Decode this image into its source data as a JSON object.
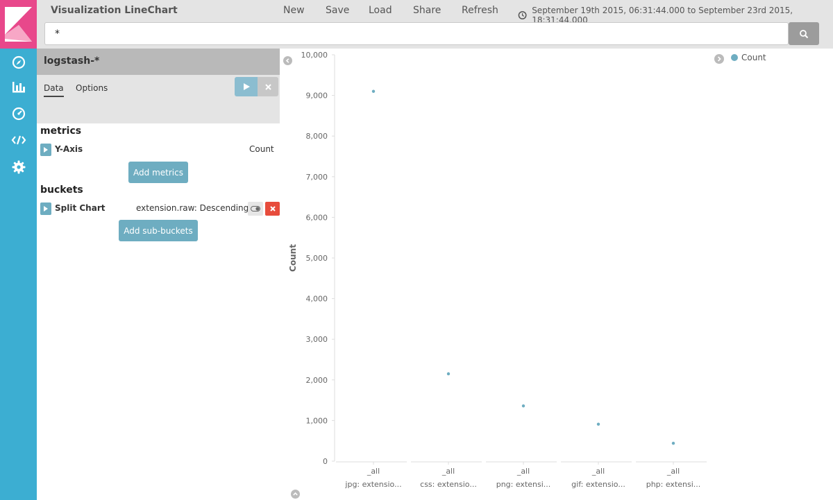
{
  "app": {
    "title": "Visualization LineChart",
    "brand_color": "#e8488b",
    "nav_color": "#3caed2"
  },
  "nav": {
    "icons": [
      "compass-icon",
      "bar-chart-icon",
      "dashboard-gauge-icon",
      "code-icon",
      "gear-icon"
    ]
  },
  "menu": {
    "new": "New",
    "save": "Save",
    "load": "Load",
    "share": "Share",
    "refresh": "Refresh"
  },
  "timerange": {
    "label": "September 19th 2015, 06:31:44.000 to September 23rd 2015, 18:31:44.000"
  },
  "search": {
    "value": "*"
  },
  "sidebar": {
    "index_pattern": "logstash-*",
    "tabs": [
      {
        "label": "Data",
        "active": true
      },
      {
        "label": "Options",
        "active": false
      }
    ],
    "metrics_title": "metrics",
    "metric_agg": {
      "title": "Y-Axis",
      "description": "Count"
    },
    "add_metrics_label": "Add metrics",
    "buckets_title": "buckets",
    "bucket_agg": {
      "title": "Split Chart",
      "description": "extension.raw: Descending"
    },
    "add_buckets_label": "Add sub-buckets"
  },
  "chart_data": {
    "type": "scatter",
    "title": "",
    "ylabel": "Count",
    "xlabel": "",
    "ylim": [
      0,
      10000
    ],
    "yticks": [
      0,
      1000,
      2000,
      3000,
      4000,
      5000,
      6000,
      7000,
      8000,
      9000,
      10000
    ],
    "ytick_labels": [
      "0",
      "1,000",
      "2,000",
      "3,000",
      "4,000",
      "5,000",
      "6,000",
      "7,000",
      "8,000",
      "9,000",
      "10,000"
    ],
    "grid": false,
    "legend": "top-right",
    "series": [
      {
        "name": "Count",
        "color": "#6eadc1",
        "points": [
          {
            "panel": "jpg: extensio...",
            "x": "_all",
            "y": 9100
          },
          {
            "panel": "css: extensio...",
            "x": "_all",
            "y": 2150
          },
          {
            "panel": "png: extensi...",
            "x": "_all",
            "y": 1360
          },
          {
            "panel": "gif: extensio...",
            "x": "_all",
            "y": 910
          },
          {
            "panel": "php: extensi...",
            "x": "_all",
            "y": 440
          }
        ]
      }
    ]
  }
}
